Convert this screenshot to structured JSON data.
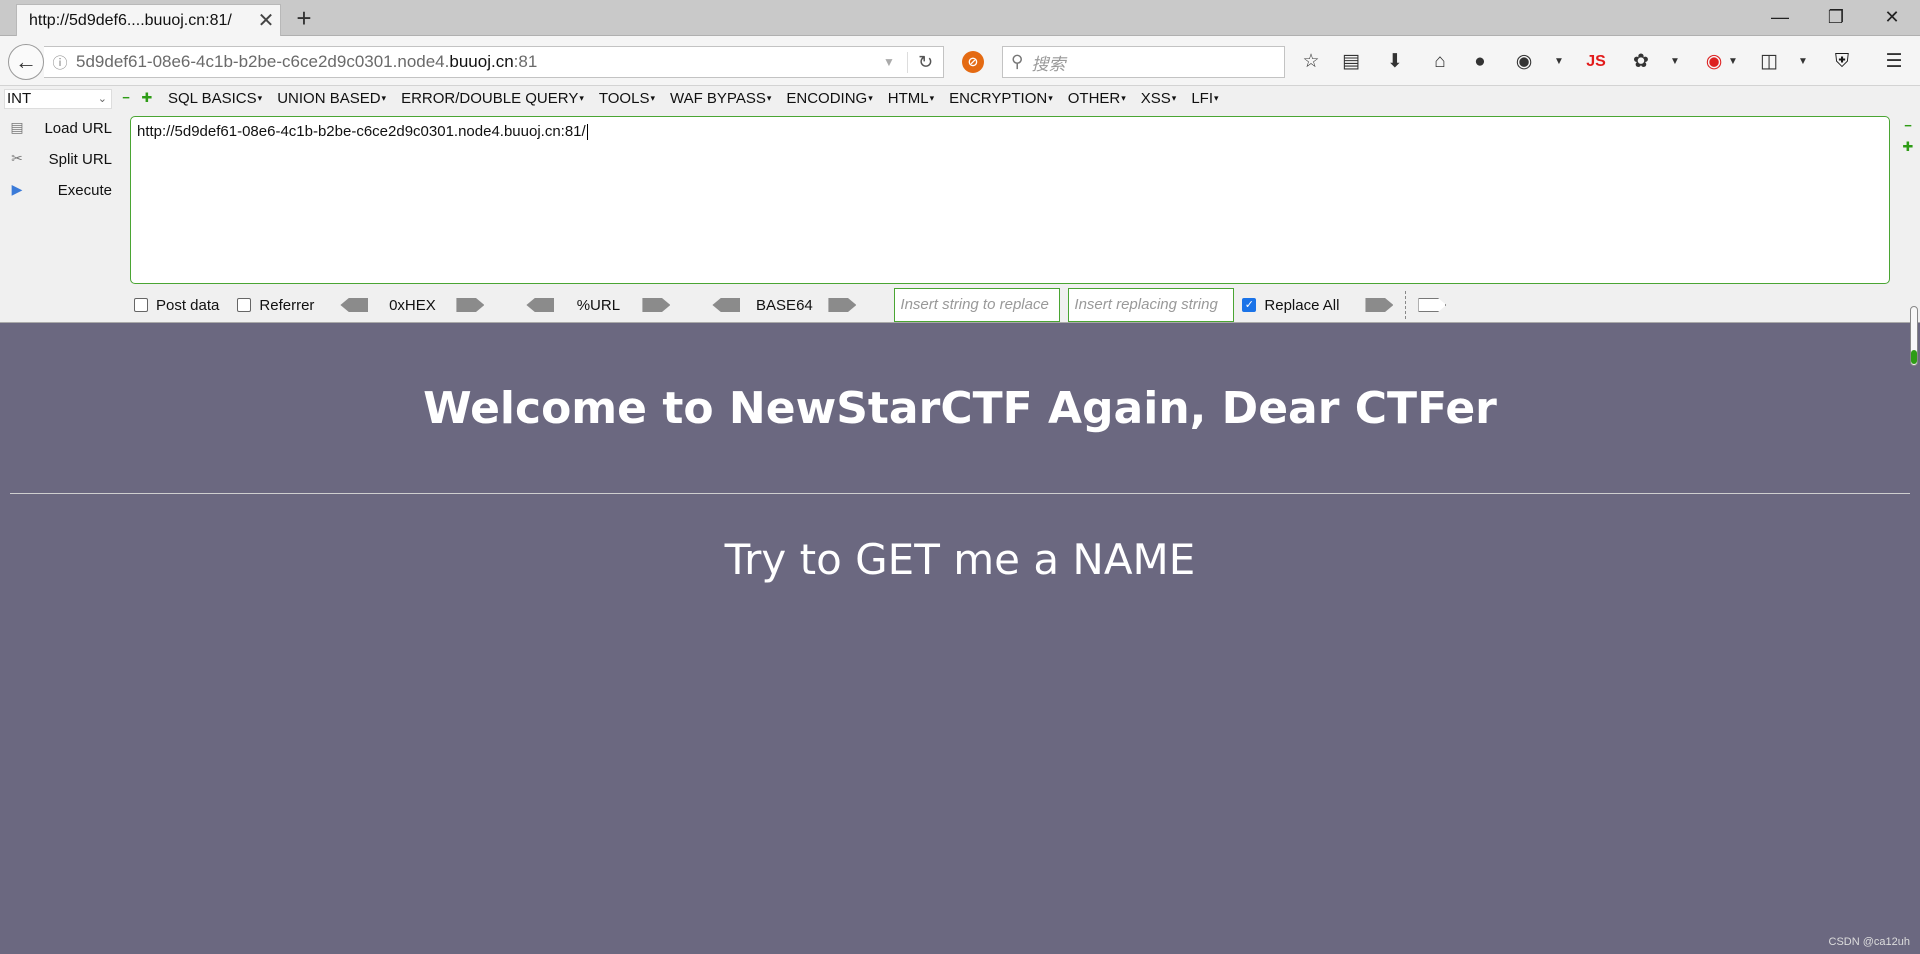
{
  "browser": {
    "tab_title": "http://5d9def6....buuoj.cn:81/",
    "close_glyph": "✕",
    "newtab_glyph": "+",
    "url_prefix": "5d9def61-08e6-4c1b-b2be-c6ce2d9c0301.node4.",
    "url_domain": "buuoj.cn",
    "url_suffix": ":81",
    "search_placeholder": "搜索",
    "js_label": "JS"
  },
  "hackbar": {
    "type_select": "INT",
    "menus": [
      "SQL BASICS",
      "UNION BASED",
      "ERROR/DOUBLE QUERY",
      "TOOLS",
      "WAF BYPASS",
      "ENCODING",
      "HTML",
      "ENCRYPTION",
      "OTHER",
      "XSS",
      "LFI"
    ],
    "actions": {
      "load": "Load URL",
      "split": "Split URL",
      "execute": "Execute"
    },
    "url_value": "http://5d9def61-08e6-4c1b-b2be-c6ce2d9c0301.node4.buuoj.cn:81/",
    "post_data_label": "Post data",
    "referrer_label": "Referrer",
    "hex_label": "0xHEX",
    "url_enc_label": "%URL",
    "base64_label": "BASE64",
    "replace_from_placeholder": "Insert string to replace",
    "replace_to_placeholder": "Insert replacing string",
    "replace_all_label": "Replace All",
    "replace_all_checked": true
  },
  "page": {
    "heading": "Welcome to NewStarCTF Again, Dear CTFer",
    "message": "Try to GET me a NAME",
    "background_color": "#6b6880"
  },
  "watermark": "CSDN @ca12uh"
}
